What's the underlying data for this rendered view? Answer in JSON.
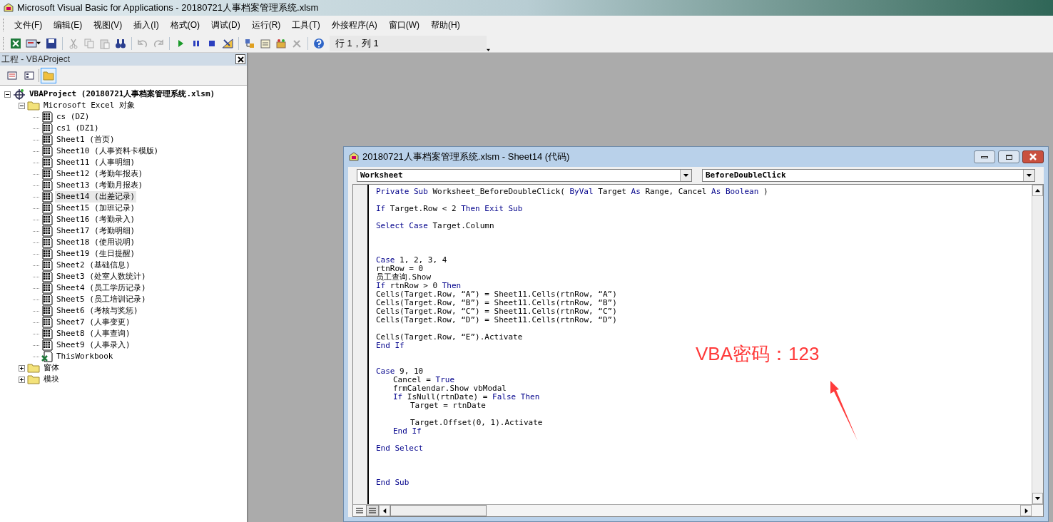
{
  "window": {
    "title": "Microsoft Visual Basic for Applications - 20180721人事档案管理系统.xlsm"
  },
  "menu": [
    "文件(F)",
    "编辑(E)",
    "视图(V)",
    "插入(I)",
    "格式(O)",
    "调试(D)",
    "运行(R)",
    "工具(T)",
    "外接程序(A)",
    "窗口(W)",
    "帮助(H)"
  ],
  "toolbar": {
    "position": "行 1，列 1"
  },
  "project_explorer": {
    "title": "工程 - VBAProject",
    "tree": [
      {
        "label": "VBAProject (20180721人事档案管理系统.xlsm)",
        "kind": "project",
        "bold": true,
        "expanded": true,
        "selected": false,
        "children": [
          {
            "label": "Microsoft Excel 对象",
            "kind": "folder",
            "expanded": true,
            "selected": false,
            "children": [
              {
                "label": "cs (DZ)",
                "kind": "sheet",
                "selected": false
              },
              {
                "label": "cs1 (DZ1)",
                "kind": "sheet",
                "selected": false
              },
              {
                "label": "Sheet1 (首页)",
                "kind": "sheet",
                "selected": false
              },
              {
                "label": "Sheet10 (人事资料卡模版)",
                "kind": "sheet",
                "selected": false
              },
              {
                "label": "Sheet11 (人事明细)",
                "kind": "sheet",
                "selected": false
              },
              {
                "label": "Sheet12 (考勤年报表)",
                "kind": "sheet",
                "selected": false
              },
              {
                "label": "Sheet13 (考勤月报表)",
                "kind": "sheet",
                "selected": false
              },
              {
                "label": "Sheet14 (出差记录)",
                "kind": "sheet",
                "selected": true
              },
              {
                "label": "Sheet15 (加班记录)",
                "kind": "sheet",
                "selected": false
              },
              {
                "label": "Sheet16 (考勤录入)",
                "kind": "sheet",
                "selected": false
              },
              {
                "label": "Sheet17 (考勤明细)",
                "kind": "sheet",
                "selected": false
              },
              {
                "label": "Sheet18 (使用说明)",
                "kind": "sheet",
                "selected": false
              },
              {
                "label": "Sheet19 (生日提醒)",
                "kind": "sheet",
                "selected": false
              },
              {
                "label": "Sheet2 (基础信息)",
                "kind": "sheet",
                "selected": false
              },
              {
                "label": "Sheet3 (处室人数统计)",
                "kind": "sheet",
                "selected": false
              },
              {
                "label": "Sheet4 (员工学历记录)",
                "kind": "sheet",
                "selected": false
              },
              {
                "label": "Sheet5 (员工培训记录)",
                "kind": "sheet",
                "selected": false
              },
              {
                "label": "Sheet6 (考核与奖惩)",
                "kind": "sheet",
                "selected": false
              },
              {
                "label": "Sheet7 (人事变更)",
                "kind": "sheet",
                "selected": false
              },
              {
                "label": "Sheet8 (人事查询)",
                "kind": "sheet",
                "selected": false
              },
              {
                "label": "Sheet9 (人事录入)",
                "kind": "sheet",
                "selected": false
              },
              {
                "label": "ThisWorkbook",
                "kind": "workbook",
                "selected": false
              }
            ]
          },
          {
            "label": "窗体",
            "kind": "folder",
            "expanded": false,
            "selected": false
          },
          {
            "label": "模块",
            "kind": "folder",
            "expanded": false,
            "selected": false
          }
        ]
      }
    ]
  },
  "code_window": {
    "title": "20180721人事档案管理系统.xlsm - Sheet14 (代码)",
    "object": "Worksheet",
    "procedure": "BeforeDoubleClick",
    "lines": [
      {
        "kind": "code",
        "tokens": [
          {
            "text": "Private Sub",
            "kind": "keyword"
          },
          {
            "text": "Worksheet_BeforeDoubleClick(",
            "kind": "plain"
          },
          {
            "text": "ByVal",
            "kind": "keyword"
          },
          {
            "text": "Target",
            "kind": "plain"
          },
          {
            "text": "As",
            "kind": "keyword"
          },
          {
            "text": "Range, Cancel",
            "kind": "plain"
          },
          {
            "text": "As Boolean",
            "kind": "keyword"
          },
          {
            "text": ")",
            "kind": "plain"
          }
        ]
      },
      {
        "kind": "blank"
      },
      {
        "kind": "code",
        "tokens": [
          {
            "text": "If",
            "kind": "keyword"
          },
          {
            "text": "Target.Row < 2",
            "kind": "plain"
          },
          {
            "text": "Then Exit Sub",
            "kind": "keyword"
          }
        ]
      },
      {
        "kind": "blank"
      },
      {
        "kind": "code",
        "tokens": [
          {
            "text": "Select Case",
            "kind": "keyword"
          },
          {
            "text": "Target.Column",
            "kind": "plain"
          }
        ]
      },
      {
        "kind": "blank"
      },
      {
        "kind": "blank"
      },
      {
        "kind": "blank"
      },
      {
        "kind": "code",
        "tokens": [
          {
            "text": "Case",
            "kind": "keyword"
          },
          {
            "text": "1, 2, 3, 4",
            "kind": "plain"
          }
        ]
      },
      {
        "kind": "code",
        "tokens": [
          {
            "text": "rtnRow = 0",
            "kind": "plain"
          }
        ]
      },
      {
        "kind": "code",
        "tokens": [
          {
            "text": "员工查询.Show",
            "kind": "plain"
          }
        ]
      },
      {
        "kind": "code",
        "tokens": [
          {
            "text": "If",
            "kind": "keyword"
          },
          {
            "text": "rtnRow > 0",
            "kind": "plain"
          },
          {
            "text": "Then",
            "kind": "keyword"
          }
        ]
      },
      {
        "kind": "code",
        "tokens": [
          {
            "text": "Cells(Target.Row, “A”) = Sheet11.Cells(rtnRow, “A”)",
            "kind": "plain"
          }
        ]
      },
      {
        "kind": "code",
        "tokens": [
          {
            "text": "Cells(Target.Row, “B”) = Sheet11.Cells(rtnRow, “B”)",
            "kind": "plain"
          }
        ]
      },
      {
        "kind": "code",
        "tokens": [
          {
            "text": "Cells(Target.Row, “C”) = Sheet11.Cells(rtnRow, “C”)",
            "kind": "plain"
          }
        ]
      },
      {
        "kind": "code",
        "tokens": [
          {
            "text": "Cells(Target.Row, “D”) = Sheet11.Cells(rtnRow, “D”)",
            "kind": "plain"
          }
        ]
      },
      {
        "kind": "blank"
      },
      {
        "kind": "code",
        "tokens": [
          {
            "text": "Cells(Target.Row, “E”).Activate",
            "kind": "plain"
          }
        ]
      },
      {
        "kind": "code",
        "tokens": [
          {
            "text": "End If",
            "kind": "keyword"
          }
        ]
      },
      {
        "kind": "blank"
      },
      {
        "kind": "blank"
      },
      {
        "kind": "code",
        "tokens": [
          {
            "text": "Case",
            "kind": "keyword"
          },
          {
            "text": "9, 10",
            "kind": "plain"
          }
        ],
        "children": [
          {
            "kind": "code",
            "tokens": [
              {
                "text": "Cancel =",
                "kind": "plain"
              },
              {
                "text": "True",
                "kind": "keyword"
              }
            ]
          },
          {
            "kind": "code",
            "tokens": [
              {
                "text": "frmCalendar.Show vbModal",
                "kind": "plain"
              }
            ]
          },
          {
            "kind": "code",
            "tokens": [
              {
                "text": "If",
                "kind": "keyword"
              },
              {
                "text": "IsNull(rtnDate) =",
                "kind": "plain"
              },
              {
                "text": "False Then",
                "kind": "keyword"
              }
            ],
            "children": [
              {
                "kind": "code",
                "tokens": [
                  {
                    "text": "Target = rtnDate",
                    "kind": "plain"
                  }
                ]
              },
              {
                "kind": "blank"
              },
              {
                "kind": "code",
                "tokens": [
                  {
                    "text": "Target.Offset(0, 1).Activate",
                    "kind": "plain"
                  }
                ]
              }
            ]
          },
          {
            "kind": "code",
            "tokens": [
              {
                "text": "End If",
                "kind": "keyword"
              }
            ]
          }
        ]
      },
      {
        "kind": "blank"
      },
      {
        "kind": "code",
        "tokens": [
          {
            "text": "End Select",
            "kind": "keyword"
          }
        ]
      },
      {
        "kind": "blank"
      },
      {
        "kind": "blank"
      },
      {
        "kind": "blank"
      },
      {
        "kind": "code",
        "tokens": [
          {
            "text": "End Sub",
            "kind": "keyword"
          }
        ]
      }
    ]
  },
  "annotation": {
    "text": "VBA密码：123"
  }
}
